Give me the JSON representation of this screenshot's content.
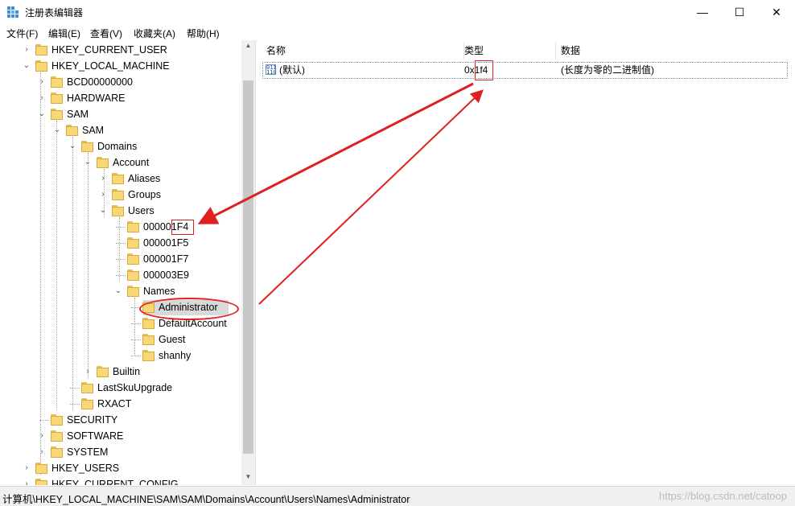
{
  "window": {
    "title": "注册表编辑器",
    "minimize": "—",
    "maximize": "☐",
    "close": "✕"
  },
  "menu": [
    "文件(F)",
    "编辑(E)",
    "查看(V)",
    "收藏夹(A)",
    "帮助(H)"
  ],
  "tree": {
    "nodes": [
      {
        "label": "HKEY_CURRENT_USER",
        "expander": "›"
      },
      {
        "label": "HKEY_LOCAL_MACHINE",
        "expander": "⌄"
      },
      {
        "label": "BCD00000000",
        "expander": "›"
      },
      {
        "label": "HARDWARE",
        "expander": "›"
      },
      {
        "label": "SAM",
        "expander": "⌄"
      },
      {
        "label": "SAM",
        "expander": "⌄"
      },
      {
        "label": "Domains",
        "expander": "⌄"
      },
      {
        "label": "Account",
        "expander": "⌄"
      },
      {
        "label": "Aliases",
        "expander": "›"
      },
      {
        "label": "Groups",
        "expander": "›"
      },
      {
        "label": "Users",
        "expander": "⌄"
      },
      {
        "label": "000001F4",
        "expander": ""
      },
      {
        "label": "000001F5",
        "expander": ""
      },
      {
        "label": "000001F7",
        "expander": ""
      },
      {
        "label": "000003E9",
        "expander": ""
      },
      {
        "label": "Names",
        "expander": "⌄"
      },
      {
        "label": "Administrator",
        "expander": ""
      },
      {
        "label": "DefaultAccount",
        "expander": ""
      },
      {
        "label": "Guest",
        "expander": ""
      },
      {
        "label": "shanhy",
        "expander": ""
      },
      {
        "label": "Builtin",
        "expander": "›"
      },
      {
        "label": "LastSkuUpgrade",
        "expander": ""
      },
      {
        "label": "RXACT",
        "expander": ""
      },
      {
        "label": "SECURITY",
        "expander": ""
      },
      {
        "label": "SOFTWARE",
        "expander": "›"
      },
      {
        "label": "SYSTEM",
        "expander": "›"
      },
      {
        "label": "HKEY_USERS",
        "expander": "›"
      },
      {
        "label": "HKEY_CURRENT_CONFIG",
        "expander": "›"
      }
    ],
    "selected": "Administrator"
  },
  "list": {
    "columns": [
      "名称",
      "类型",
      "数据"
    ],
    "rows": [
      {
        "name": "(默认)",
        "type": "0x1f4",
        "data": "(长度为零的二进制值)"
      }
    ]
  },
  "status": {
    "path": "计算机\\HKEY_LOCAL_MACHINE\\SAM\\SAM\\Domains\\Account\\Users\\Names\\Administrator",
    "watermark": "https://blog.csdn.net/catoop"
  },
  "annotation_color": "#e02020"
}
